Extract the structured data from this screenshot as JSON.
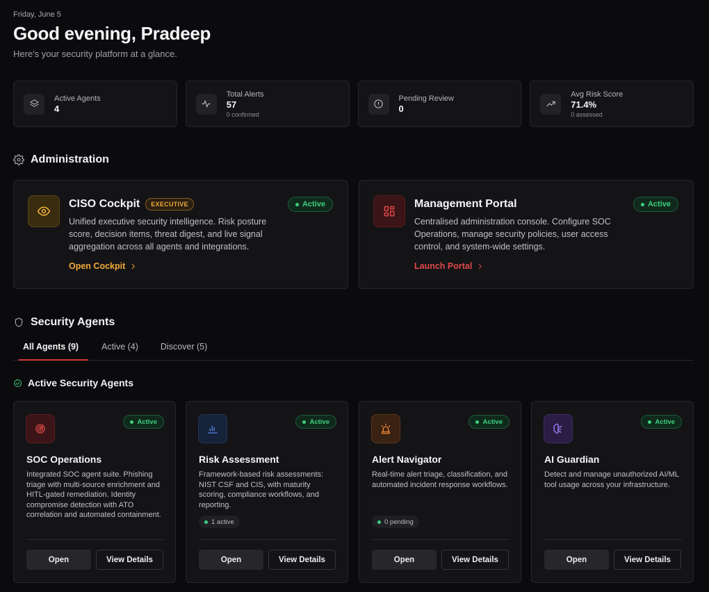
{
  "header": {
    "date": "Friday, June 5",
    "greeting": "Good evening, Pradeep",
    "subtitle": "Here's your security platform at a glance."
  },
  "stats": [
    {
      "label": "Active Agents",
      "value": "4",
      "sub": "",
      "icon": "layers-icon"
    },
    {
      "label": "Total Alerts",
      "value": "57",
      "sub": "0 confirmed",
      "icon": "activity-icon"
    },
    {
      "label": "Pending Review",
      "value": "0",
      "sub": "",
      "icon": "alert-circle-icon"
    },
    {
      "label": "Avg Risk Score",
      "value": "71.4%",
      "sub": "0 assessed",
      "icon": "trending-up-icon"
    }
  ],
  "administration": {
    "title": "Administration",
    "cards": [
      {
        "title": "CISO Cockpit",
        "badge": "EXECUTIVE",
        "status": "Active",
        "description": "Unified executive security intelligence. Risk posture score, decision items, threat digest, and live signal aggregation across all agents and integrations.",
        "link": "Open Cockpit",
        "accent": "#f2a93b",
        "icon": "eye-icon"
      },
      {
        "title": "Management Portal",
        "status": "Active",
        "description": "Centralised administration console. Configure SOC Operations, manage security policies, user access control, and system-wide settings.",
        "link": "Launch Portal",
        "accent": "#e04848",
        "icon": "layout-grid-icon"
      }
    ]
  },
  "security_agents": {
    "title": "Security Agents",
    "tabs": [
      "All Agents (9)",
      "Active (4)",
      "Discover (5)"
    ],
    "active_section_title": "Active Security Agents",
    "agents": [
      {
        "title": "SOC Operations",
        "status": "Active",
        "description": "Integrated SOC agent suite. Phishing triage with multi-source enrichment and HITL-gated remediation. Identity compromise detection with ATO correlation and automated containment.",
        "meta": "",
        "icon": "radar-icon",
        "accent": "#e04848"
      },
      {
        "title": "Risk Assessment",
        "status": "Active",
        "description": "Framework-based risk assessments: NIST CSF and CIS, with maturity scoring, compliance workflows, and reporting.",
        "meta": "1 active",
        "icon": "bar-chart-icon",
        "accent": "#4f8fe8"
      },
      {
        "title": "Alert Navigator",
        "status": "Active",
        "description": "Real-time alert triage, classification, and automated incident response workflows.",
        "meta": "0 pending",
        "icon": "siren-icon",
        "accent": "#f08a3a"
      },
      {
        "title": "AI Guardian",
        "status": "Active",
        "description": "Detect and manage unauthorized AI/ML tool usage across your infrastructure.",
        "meta": "",
        "icon": "brain-icon",
        "accent": "#9b7cf0"
      }
    ],
    "open_label": "Open",
    "details_label": "View Details"
  }
}
